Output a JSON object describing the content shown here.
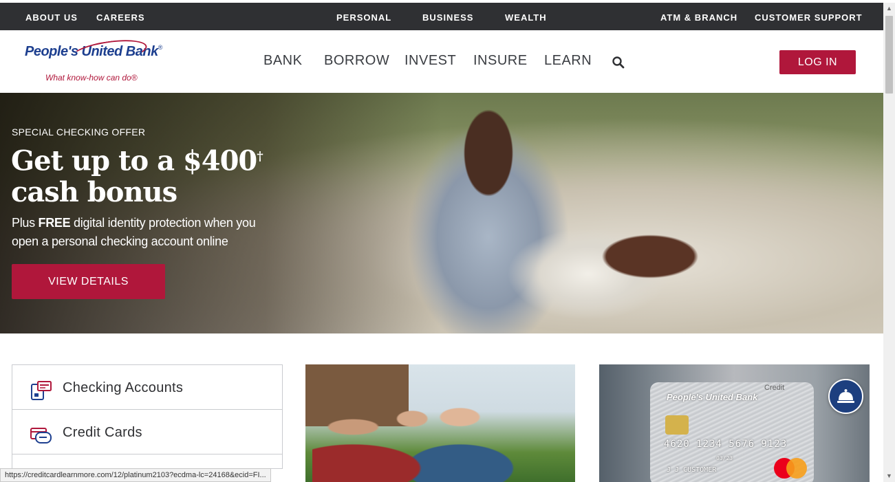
{
  "top_nav": {
    "left": [
      "ABOUT US",
      "CAREERS"
    ],
    "center": [
      "PERSONAL",
      "BUSINESS",
      "WEALTH"
    ],
    "right": [
      "ATM & BRANCH",
      "CUSTOMER SUPPORT"
    ],
    "active": "PERSONAL"
  },
  "header": {
    "logo_text": "People's United Bank",
    "logo_registered": "®",
    "tagline": "What know-how can do®",
    "nav": [
      "BANK",
      "BORROW",
      "INVEST",
      "INSURE",
      "LEARN"
    ],
    "search_icon": "search-icon",
    "login_label": "LOG IN"
  },
  "hero": {
    "eyebrow": "SPECIAL CHECKING OFFER",
    "headline_pre": "Get up to a $400",
    "headline_dagger": "†",
    "headline_post": " cash bonus",
    "sub_plus": "Plus ",
    "sub_free": "FREE",
    "sub_rest": " digital identity protection when you open a personal checking account online",
    "cta_label": "VIEW DETAILS"
  },
  "quick_links": [
    {
      "label": "Checking Accounts",
      "icon": "checking-icon"
    },
    {
      "label": "Credit Cards",
      "icon": "credit-card-icon"
    }
  ],
  "card_promo": {
    "credit_label": "Credit",
    "brand": "People's United Bank",
    "number": "4620 1234 5676 9123",
    "holder": "J J CUSTOMER",
    "expiry": "03/23"
  },
  "status_url": "https://creditcardlearnmore.com/12/platinum2103?ecdma-lc=24168&ecid=FI...",
  "colors": {
    "brand_red": "#b0173b",
    "brand_blue": "#1d3f8f",
    "topbar_bg": "#2f3033"
  }
}
